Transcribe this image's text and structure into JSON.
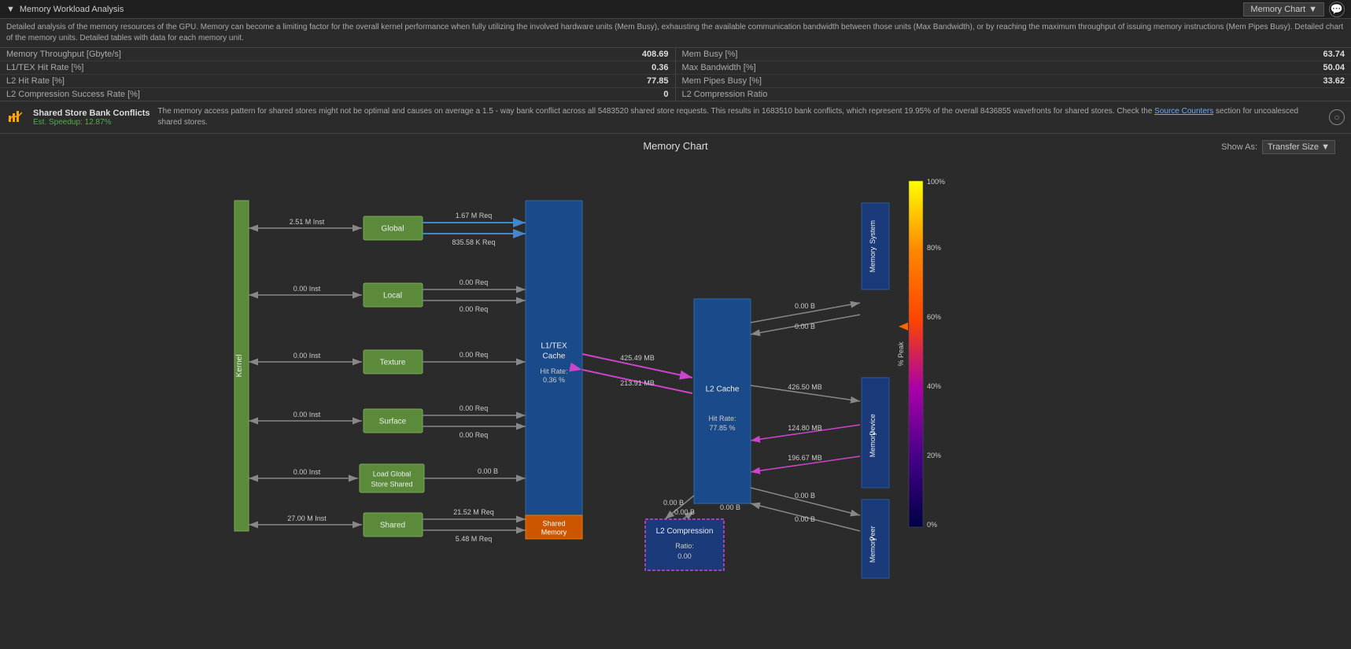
{
  "titleBar": {
    "title": "Memory Workload Analysis",
    "chartDropdown": "Memory Chart",
    "chatIcon": "💬"
  },
  "infoText": "Detailed analysis of the memory resources of the GPU. Memory can become a limiting factor for the overall kernel performance when fully utilizing the involved hardware units (Mem Busy), exhausting the available communication bandwidth between those units (Max Bandwidth), or by reaching the maximum throughput of issuing memory instructions (Mem Pipes Busy). Detailed chart of the memory units. Detailed tables with data for each memory unit.",
  "metrics": {
    "left": [
      {
        "label": "Memory Throughput [Gbyte/s]",
        "value": "408.69"
      },
      {
        "label": "L1/TEX Hit Rate [%]",
        "value": "0.36"
      },
      {
        "label": "L2 Hit Rate [%]",
        "value": "77.85"
      },
      {
        "label": "L2 Compression Success Rate [%]",
        "value": "0"
      }
    ],
    "right": [
      {
        "label": "Mem Busy [%]",
        "value": "63.74"
      },
      {
        "label": "Max Bandwidth [%]",
        "value": "50.04"
      },
      {
        "label": "Mem Pipes Busy [%]",
        "value": "33.62"
      },
      {
        "label": "L2 Compression Ratio",
        "value": ""
      }
    ]
  },
  "alert": {
    "title": "Shared Store Bank Conflicts",
    "speedup": "Est. Speedup: 12.87%",
    "text": "The memory access pattern for shared stores might not be optimal and causes on average a 1.5 - way bank conflict across all 5483520 shared store requests. This results in 1683510 bank conflicts, which represent 19.95% of the overall 8436855 wavefronts for shared stores. Check the ",
    "linkText": "Source Counters",
    "textAfterLink": " section for uncoalesced shared stores."
  },
  "chartTitle": "Memory Chart",
  "showAs": {
    "label": "Show As:",
    "dropdown": "Transfer Size",
    "dropdownArrow": "▼"
  },
  "chart": {
    "kernel": "Kernel",
    "nodes": {
      "global": "Global",
      "local": "Local",
      "texture": "Texture",
      "surface": "Surface",
      "loadGlobalStoreShared": [
        "Load Global",
        "Store Shared"
      ],
      "shared": "Shared",
      "l1tex": [
        "L1/TEX",
        "Cache"
      ],
      "l1texHitRate": [
        "Hit Rate:",
        "0.36 %"
      ],
      "l2cache": "L2 Cache",
      "l2hitRate": [
        "Hit Rate:",
        "77.85 %"
      ],
      "sharedMemory": [
        "Shared",
        "Memory"
      ],
      "systemMemory": [
        "System",
        "Memory"
      ],
      "deviceMemory": [
        "Device",
        "Memory"
      ],
      "peerMemory": [
        "Peer",
        "Memory"
      ],
      "l2compression": [
        "L2 Compression"
      ],
      "l2compressionRatio": [
        "Ratio:",
        "0.00"
      ]
    },
    "flows": {
      "global_inst": "2.51 M Inst",
      "global_req1": "1.67 M Req",
      "global_req2": "835.58 K Req",
      "local_inst": "0.00 Inst",
      "local_req1": "0.00 Req",
      "local_req2": "0.00 Req",
      "texture_inst": "0.00 Inst",
      "texture_req": "0.00 Req",
      "surface_inst": "0.00 Inst",
      "surface_req1": "0.00 Req",
      "surface_req2": "0.00 Req",
      "lgs_inst": "0.00 Inst",
      "lgs_val": "0.00 B",
      "shared_inst": "27.00 M Inst",
      "shared_req1": "21.52 M Req",
      "shared_req2": "5.48 M Req",
      "l1_l2_top": "425.49 MB",
      "l1_l2_bot": "213.91 MB",
      "l2_dev_top": "426.50 MB",
      "l2_dev_bot2": "124.80 MB",
      "l2_dev_bot3": "196.67 MB",
      "l2_sys_top": "0.00 B",
      "l2_sys_bot": "0.00 B",
      "l2_peer_top": "0.00 B",
      "l2_peer_bot": "0.00 B",
      "l2_comp_top": "0.00 B",
      "l2_comp_bot": "0.00 B",
      "l2_comp_side1": "0.00 B",
      "l2_comp_side2": "0.00 B"
    },
    "colorBar": {
      "labels": [
        "100%",
        "80%",
        "60%",
        "40%",
        "20%",
        "0%"
      ],
      "title": "% Peak"
    }
  }
}
